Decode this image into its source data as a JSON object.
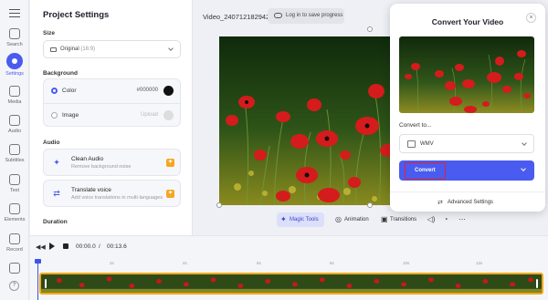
{
  "rail": {
    "items": [
      {
        "label": "Search",
        "icon": "search-icon"
      },
      {
        "label": "Settings",
        "icon": "settings-icon"
      },
      {
        "label": "Media",
        "icon": "media-icon"
      },
      {
        "label": "Audio",
        "icon": "audio-icon"
      },
      {
        "label": "Subtitles",
        "icon": "subtitles-icon"
      },
      {
        "label": "Text",
        "icon": "text-icon"
      },
      {
        "label": "Elements",
        "icon": "elements-icon"
      },
      {
        "label": "Record",
        "icon": "record-icon"
      }
    ],
    "help": "?"
  },
  "settings": {
    "title": "Project Settings",
    "size_label": "Size",
    "size_value": "Original",
    "size_ratio": "(16:9)",
    "background_label": "Background",
    "color_label": "Color",
    "color_value": "#000000",
    "image_label": "Image",
    "image_value": "Upload",
    "audio_label": "Audio",
    "clean_audio_title": "Clean Audio",
    "clean_audio_sub": "Remove background noise",
    "translate_title": "Translate voice",
    "translate_sub": "Add voice translations in multi-languages",
    "duration_label": "Duration"
  },
  "header": {
    "video_title": "Video_240712182942",
    "login_label": "Log in to save progress"
  },
  "toolbar": {
    "magic_tools": "Magic Tools",
    "animation": "Animation",
    "transitions": "Transitions"
  },
  "timeline": {
    "current_time": "00:00.0",
    "separator": "/",
    "total_time": "00:13.6",
    "ticks": [
      "2s",
      "4s",
      "6s",
      "8s",
      "10s",
      "12s"
    ]
  },
  "modal": {
    "title": "Convert Your Video",
    "close": "×",
    "convert_to_label": "Convert to...",
    "format": "WMV",
    "convert_button": "Convert",
    "advanced_settings": "Advanced Settings"
  },
  "colors": {
    "accent": "#4a5bef",
    "highlight": "#d8263c",
    "track_border": "#f2a818"
  }
}
